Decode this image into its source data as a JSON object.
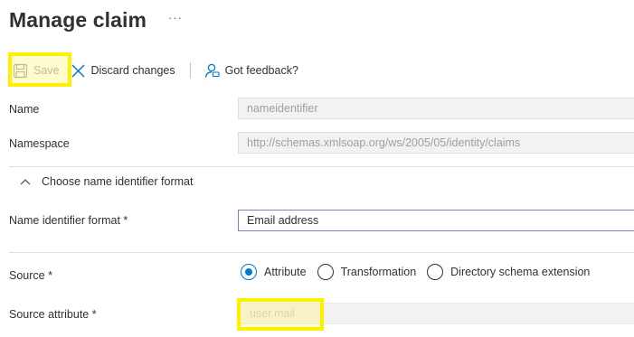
{
  "header": {
    "title": "Manage claim",
    "more_label": "···"
  },
  "toolbar": {
    "save_label": "Save",
    "discard_label": "Discard changes",
    "feedback_label": "Got feedback?"
  },
  "form": {
    "name": {
      "label": "Name",
      "value": "nameidentifier"
    },
    "namespace": {
      "label": "Namespace",
      "value": "http://schemas.xmlsoap.org/ws/2005/05/identity/claims"
    },
    "section_toggle": "Choose name identifier format",
    "name_id_format": {
      "label": "Name identifier format *",
      "value": "Email address"
    },
    "source": {
      "label": "Source *",
      "options": [
        "Attribute",
        "Transformation",
        "Directory schema extension"
      ],
      "selected": "Attribute"
    },
    "source_attribute": {
      "label": "Source attribute *",
      "value": "user.mail"
    }
  },
  "colors": {
    "accent": "#0078d4",
    "highlight": "#fff000",
    "active_border": "#8a78c8"
  },
  "icons": {
    "save": "save-icon",
    "discard": "close-icon",
    "feedback": "feedback-icon",
    "section": "chevron-up-icon"
  }
}
